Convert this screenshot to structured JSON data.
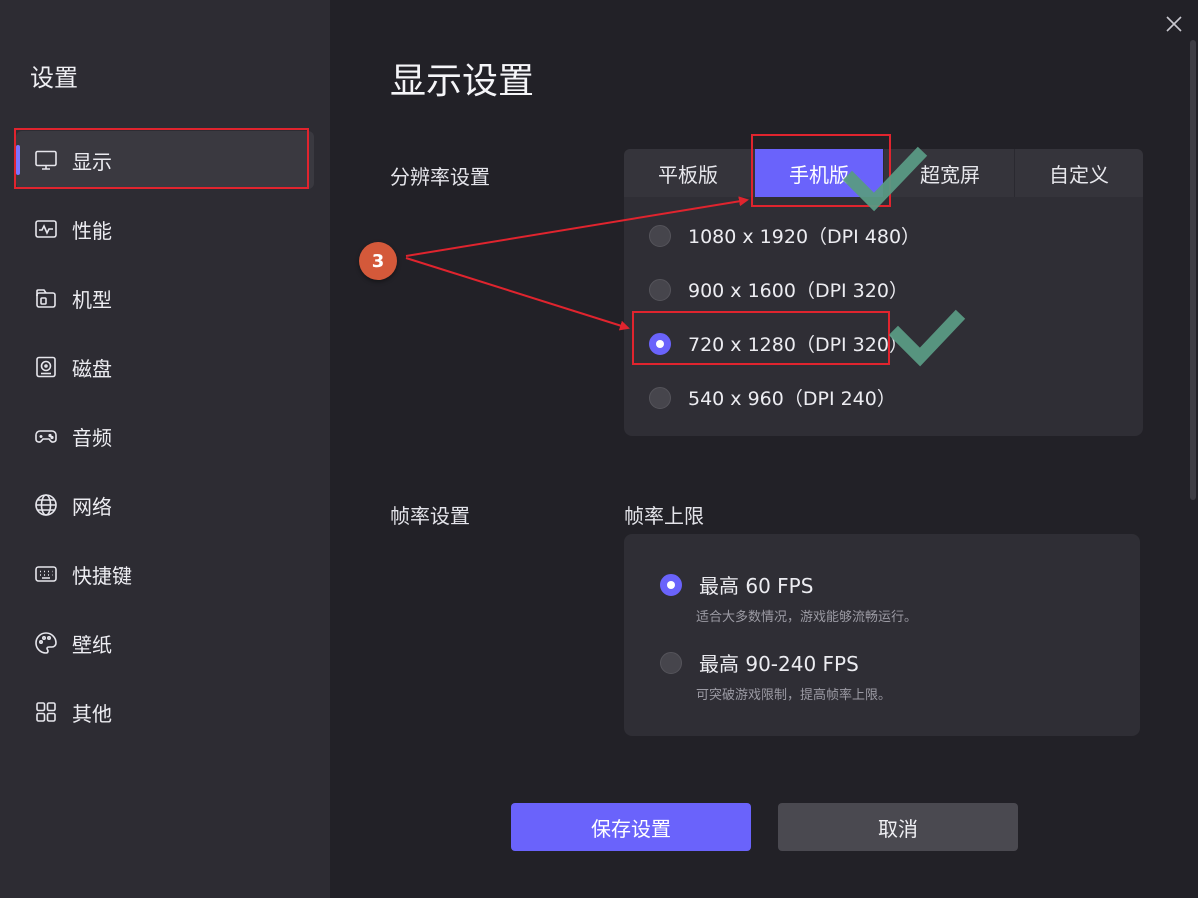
{
  "sidebar": {
    "title": "设置",
    "items": [
      {
        "label": "显示",
        "icon": "monitor-icon"
      },
      {
        "label": "性能",
        "icon": "performance-icon"
      },
      {
        "label": "机型",
        "icon": "device-model-icon"
      },
      {
        "label": "磁盘",
        "icon": "disk-icon"
      },
      {
        "label": "音频",
        "icon": "gamepad-icon"
      },
      {
        "label": "网络",
        "icon": "globe-icon"
      },
      {
        "label": "快捷键",
        "icon": "keyboard-icon"
      },
      {
        "label": "壁纸",
        "icon": "palette-icon"
      },
      {
        "label": "其他",
        "icon": "grid-icon"
      }
    ]
  },
  "main": {
    "title": "显示设置",
    "resolution": {
      "label": "分辨率设置",
      "tabs": [
        "平板版",
        "手机版",
        "超宽屏",
        "自定义"
      ],
      "active_tab": "手机版",
      "options": [
        "1080 x 1920（DPI 480）",
        "900 x 1600（DPI 320）",
        "720 x 1280（DPI 320）",
        "540 x 960（DPI 240）"
      ],
      "selected_option": "720 x 1280（DPI 320）"
    },
    "framerate": {
      "label": "帧率设置",
      "sub_label": "帧率上限",
      "options": [
        {
          "label": "最高 60 FPS",
          "desc": "适合大多数情况，游戏能够流畅运行。"
        },
        {
          "label": "最高 90-240 FPS",
          "desc": "可突破游戏限制，提高帧率上限。"
        }
      ],
      "selected_option": "最高 60 FPS"
    },
    "buttons": {
      "save": "保存设置",
      "cancel": "取消"
    }
  },
  "annotations": {
    "step_number": "3"
  },
  "colors": {
    "accent": "#6a63fb",
    "annotation_red": "#e0242e",
    "check_green": "#5a9a84",
    "badge": "#d4593a"
  }
}
